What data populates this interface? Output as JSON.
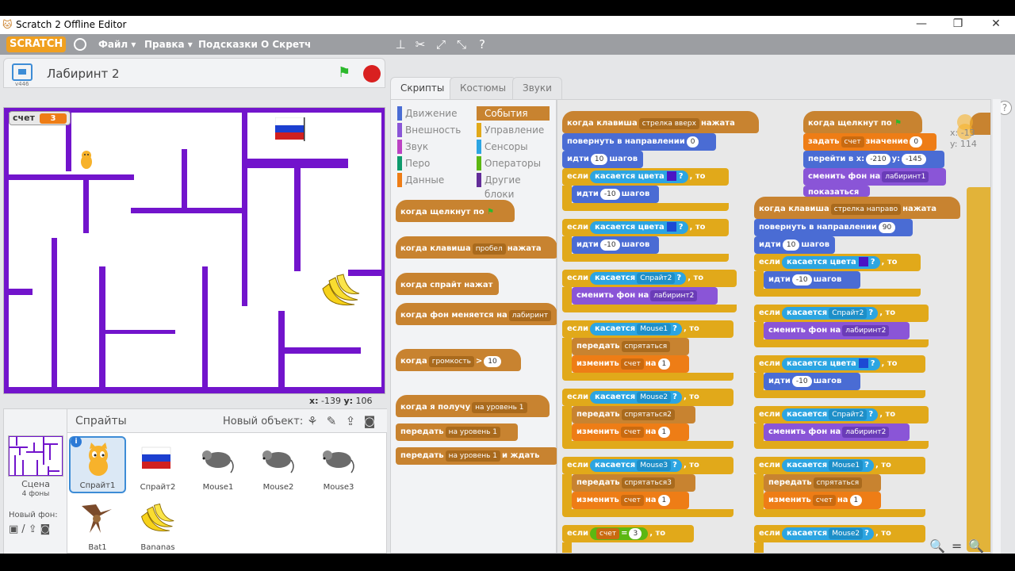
{
  "window": {
    "title": "Scratch 2 Offline Editor",
    "minimize": "—",
    "restore": "❐",
    "close": "✕"
  },
  "menubar": {
    "logo": "SCRATCH",
    "file": "Файл ▾",
    "edit": "Правка ▾",
    "tips": "Подсказки",
    "about": "О Скретч"
  },
  "stage": {
    "version": "v446",
    "project_name": "Лабиринт 2",
    "monitor_label": "счет",
    "monitor_value": "3",
    "mouse_x_label": "x:",
    "mouse_x": "-139",
    "mouse_y_label": "y:",
    "mouse_y": "106",
    "wall_color": "#7214cc"
  },
  "sprites_panel": {
    "title": "Спрайты",
    "new_object": "Новый объект:",
    "scene_label": "Сцена",
    "scene_backdrops": "4 фоны",
    "new_backdrop": "Новый фон:",
    "sprites": [
      {
        "name": "Спрайт1",
        "selected": true,
        "icon": "cat-icon"
      },
      {
        "name": "Спрайт2",
        "selected": false,
        "icon": "flag-icon"
      },
      {
        "name": "Mouse1",
        "selected": false,
        "icon": "mouse-icon"
      },
      {
        "name": "Mouse2",
        "selected": false,
        "icon": "mouse-icon"
      },
      {
        "name": "Mouse3",
        "selected": false,
        "icon": "mouse-icon"
      },
      {
        "name": "Bat1",
        "selected": false,
        "icon": "bat-icon"
      },
      {
        "name": "Bananas",
        "selected": false,
        "icon": "bananas-icon"
      }
    ]
  },
  "tabs": {
    "scripts": "Скрипты",
    "costumes": "Костюмы",
    "sounds": "Звуки"
  },
  "categories": [
    {
      "label": "Движение",
      "color": "#4a6cd4"
    },
    {
      "label": "События",
      "color": "#c88330"
    },
    {
      "label": "Внешность",
      "color": "#8a55d7"
    },
    {
      "label": "Управление",
      "color": "#e1a91a"
    },
    {
      "label": "Звук",
      "color": "#bb42c3"
    },
    {
      "label": "Сенсоры",
      "color": "#2ca5e2"
    },
    {
      "label": "Перо",
      "color": "#0e9a6c"
    },
    {
      "label": "Операторы",
      "color": "#5cb712"
    },
    {
      "label": "Данные",
      "color": "#ee7d16"
    },
    {
      "label": "Другие блоки",
      "color": "#632d99"
    }
  ],
  "palette": {
    "flag_clicked": "когда щелкнут по",
    "key_pressed": "когда клавиша",
    "key_space": "пробел",
    "key_pressed_end": "нажата",
    "sprite_clicked": "когда спрайт нажат",
    "backdrop_switch": "когда фон меняется на",
    "backdrop_name": "лабиринт",
    "loudness": "когда",
    "loudness_dd": "громкость",
    "gt": ">",
    "loudness_val": "10",
    "receive": "когда я получу",
    "receive_msg": "на уровень 1",
    "broadcast": "передать",
    "broadcast_msg": "на уровень 1",
    "broadcast_wait": "передать",
    "broadcast_wait_msg": "на уровень 1",
    "broadcast_wait_end": "и ждать"
  },
  "script1": {
    "hat": "когда клавиша",
    "hat_key": "стрелка вверх",
    "hat_end": "нажата",
    "point": "повернуть в направлении",
    "point_val": "0",
    "move": "идти",
    "move_val": "10",
    "steps": "шагов",
    "if": "если",
    "touching_color": "касается цвета",
    "q": "?",
    "then": ", то",
    "back_val": "-10",
    "touching": "касается",
    "sprite2": "Спрайт2",
    "switch_bg": "сменить фон на",
    "bg2": "лабиринт2",
    "mouse1": "Mouse1",
    "mouse2": "Mouse2",
    "mouse3": "Mouse3",
    "broadcast": "передать",
    "hide": "спрятаться",
    "hide2": "спрятаться2",
    "hide3": "спрятаться3",
    "change": "изменить",
    "var": "счет",
    "by": "на",
    "one": "1",
    "eq": "=",
    "three": "3"
  },
  "script2": {
    "hat": "когда щелкнут по",
    "set": "задать",
    "var": "счет",
    "to": "значение",
    "zero": "0",
    "goto": "перейти в x:",
    "x_val": "-210",
    "y_lbl": "y:",
    "y_val": "-145",
    "switch_bg": "сменить фон на",
    "bg1": "лабиринт1",
    "show": "показаться"
  },
  "script3": {
    "hat": "когда клавиша",
    "hat_key": "стрелка направо",
    "hat_end": "нажата",
    "point": "повернуть в направлении",
    "point_val": "90",
    "move": "идти",
    "move_val": "10",
    "steps": "шагов",
    "if": "если",
    "touching_color": "касается цвета",
    "q": "?",
    "then": ", то",
    "back_val": "-10",
    "touching": "касается",
    "sprite2": "Спрайт2",
    "mouse1": "Mouse1",
    "mouse2": "Mouse2",
    "switch_bg": "сменить фон на",
    "bg2": "лабиринт2",
    "broadcast": "передать",
    "hide": "спрятаться",
    "change": "изменить",
    "var": "счет",
    "by": "на",
    "one": "1"
  },
  "sprite_info": {
    "x": "x: -13",
    "y": "y: 114"
  },
  "zoom": {
    "out": "🔍",
    "reset": "=",
    "in": "🔍"
  }
}
